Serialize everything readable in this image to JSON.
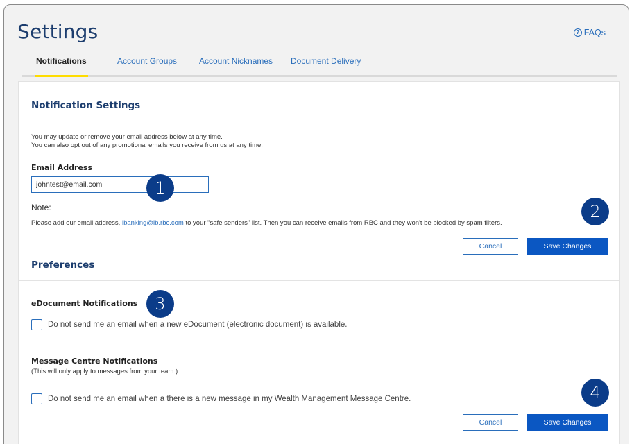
{
  "header": {
    "title": "Settings",
    "faqs_label": "FAQs",
    "faqs_icon": "?"
  },
  "tabs": [
    {
      "label": "Notifications",
      "active": true
    },
    {
      "label": "Account Groups",
      "active": false
    },
    {
      "label": "Account Nicknames",
      "active": false
    },
    {
      "label": "Document Delivery",
      "active": false
    }
  ],
  "notification_settings": {
    "heading": "Notification Settings",
    "intro_line1": "You may update or remove your email address below at any time.",
    "intro_line2": "You can also opt out of any promotional emails you receive from us at any time.",
    "email_label": "Email Address",
    "email_value": "johntest@email.com",
    "note_heading": "Note:",
    "note_before": "Please add our email address, ",
    "note_email": "ibanking@ib.rbc.com",
    "note_after": " to your \"safe senders\" list. Then you can receive emails from RBC and they won't be blocked by spam filters.",
    "cancel_label": "Cancel",
    "save_label": "Save Changes"
  },
  "preferences": {
    "heading": "Preferences",
    "edoc_heading": "eDocument Notifications",
    "edoc_checkbox_label": "Do not send me an email when a new eDocument (electronic document) is available.",
    "edoc_checked": false,
    "msg_heading": "Message Centre Notifications",
    "msg_subtext": "(This will only apply to messages from your team.)",
    "msg_checkbox_label": "Do not send me an email when a there is a new message in my Wealth Management Message Centre.",
    "msg_checked": false,
    "cancel_label": "Cancel",
    "save_label": "Save Changes"
  },
  "callouts": [
    "1",
    "2",
    "3",
    "4"
  ],
  "colors": {
    "title_navy": "#1c3d6e",
    "link_blue": "#2a6ebb",
    "primary_button": "#0b57c2",
    "tab_underline_yellow": "#fedc00",
    "callout_badge": "#0b3c89"
  }
}
